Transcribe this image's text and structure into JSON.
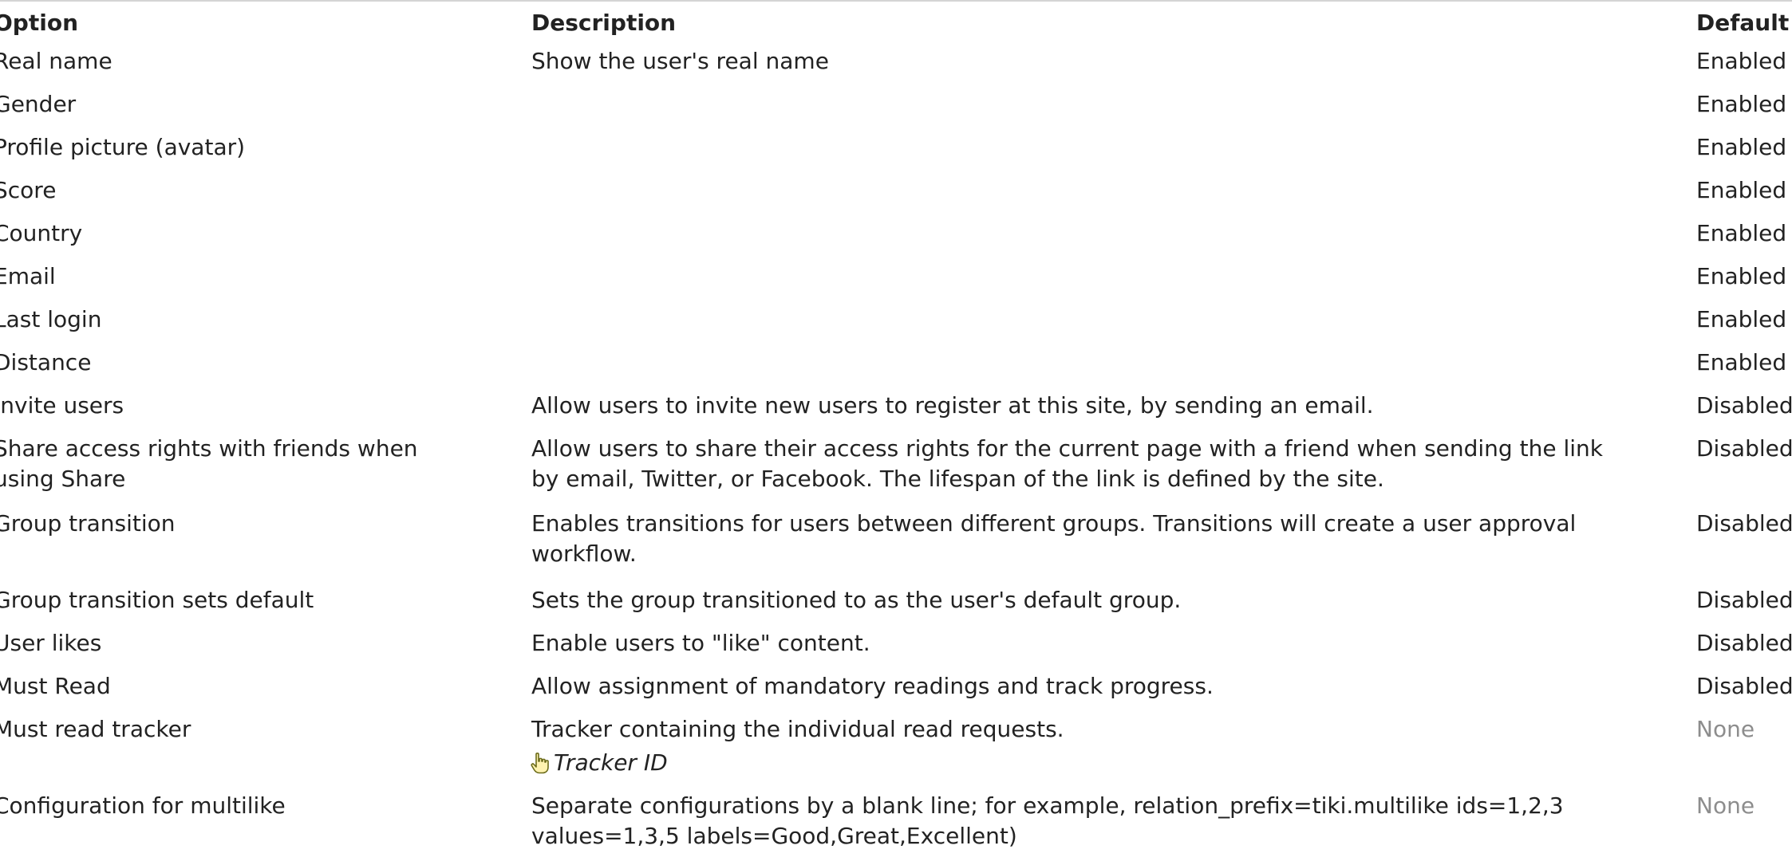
{
  "table": {
    "headers": {
      "option": "Option",
      "description": "Description",
      "default": "Default"
    },
    "rows": [
      {
        "option": [
          "Real name"
        ],
        "description": [
          "Show the user's real name"
        ],
        "default": "Enabled"
      },
      {
        "option": [
          "Gender"
        ],
        "description": [],
        "default": "Enabled"
      },
      {
        "option": [
          "Profile picture (avatar)"
        ],
        "description": [],
        "default": "Enabled"
      },
      {
        "option": [
          "Score"
        ],
        "description": [],
        "default": "Enabled"
      },
      {
        "option": [
          "Country"
        ],
        "description": [],
        "default": "Enabled"
      },
      {
        "option": [
          "Email"
        ],
        "description": [],
        "default": "Enabled"
      },
      {
        "option": [
          "Last login"
        ],
        "description": [],
        "default": "Enabled"
      },
      {
        "option": [
          "Distance"
        ],
        "description": [],
        "default": "Enabled"
      },
      {
        "option": [
          "Invite users"
        ],
        "description": [
          "Allow users to invite new users to register at this site, by sending an email."
        ],
        "default": "Disabled"
      },
      {
        "option": [
          "Share access rights with friends when",
          "using Share"
        ],
        "description": [
          "Allow users to share their access rights for the current page with a friend when sending the link",
          "by email, Twitter, or Facebook. The lifespan of the link is defined by the site."
        ],
        "default": "Disabled"
      },
      {
        "option": [
          "Group transition"
        ],
        "description": [
          "Enables transitions for users between different groups. Transitions will create a user approval",
          "workflow."
        ],
        "default": "Disabled"
      },
      {
        "option": [
          "Group transition sets default"
        ],
        "description": [
          "Sets the group transitioned to as the user's default group."
        ],
        "default": "Disabled"
      },
      {
        "option": [
          "User likes"
        ],
        "description": [
          "Enable users to \"like\" content."
        ],
        "default": "Disabled"
      },
      {
        "option": [
          "Must Read"
        ],
        "description": [
          "Allow assignment of mandatory readings and track progress."
        ],
        "default": "Disabled"
      },
      {
        "option": [
          "Must read tracker"
        ],
        "description": [
          "Tracker containing the individual read requests."
        ],
        "sub_label": "Tracker ID",
        "sub_icon": "pointing-hand-icon",
        "default": "None",
        "default_muted": true
      },
      {
        "option": [
          "Configuration for multilike"
        ],
        "description": [
          "Separate configurations by a blank line; for example, relation_prefix=tiki.multilike ids=1,2,3",
          "values=1,3,5 labels=Good,Great,Excellent)"
        ],
        "default": "None",
        "default_muted": true
      }
    ]
  },
  "colors": {
    "text": "#222222",
    "muted": "#8d8d8d",
    "rule": "#d4d4d4",
    "icon_fill": "#fff3b0",
    "icon_stroke": "#6b6b1a"
  }
}
